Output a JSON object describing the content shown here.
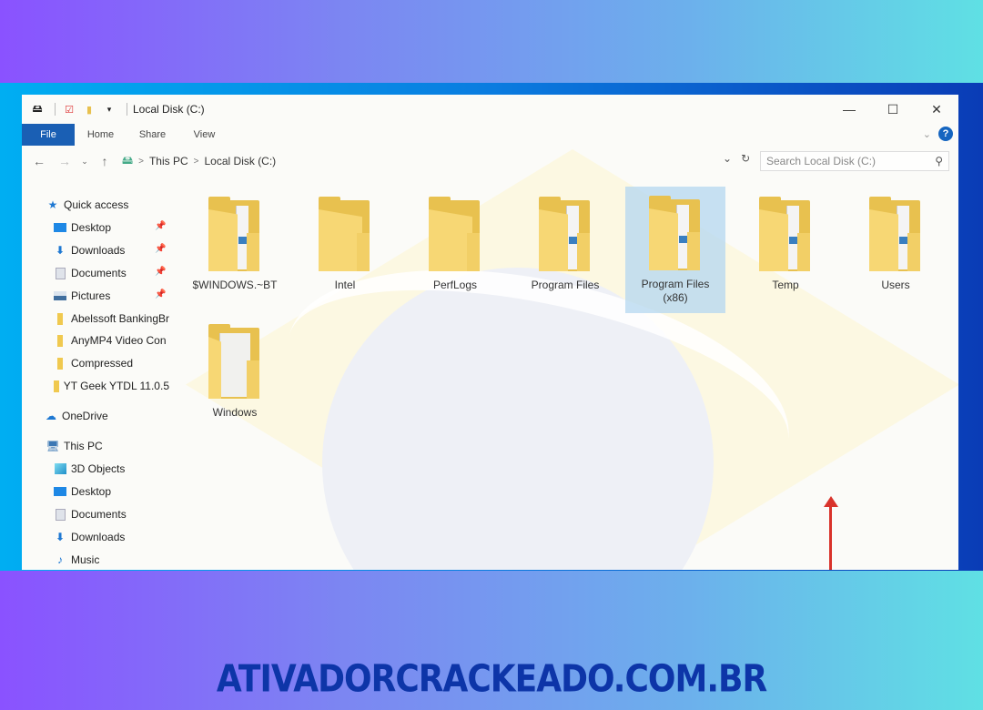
{
  "window": {
    "title": "Local Disk (C:)",
    "controls": {
      "minimize": "—",
      "maximize": "☐",
      "close": "✕"
    }
  },
  "ribbon": {
    "tabs": [
      "File",
      "Home",
      "Share",
      "View"
    ]
  },
  "address_bar": {
    "path": [
      "This PC",
      "Local Disk (C:)"
    ],
    "separator": ">",
    "search_placeholder": "Search Local Disk (C:)"
  },
  "sidebar": {
    "quick_access": {
      "label": "Quick access",
      "items": [
        {
          "label": "Desktop",
          "icon": "desktop-icon",
          "pinned": true
        },
        {
          "label": "Downloads",
          "icon": "download-icon",
          "pinned": true
        },
        {
          "label": "Documents",
          "icon": "documents-icon",
          "pinned": true
        },
        {
          "label": "Pictures",
          "icon": "pictures-icon",
          "pinned": true
        },
        {
          "label": "Abelssoft BankingBr",
          "icon": "folder-icon",
          "pinned": false
        },
        {
          "label": "AnyMP4 Video Con",
          "icon": "folder-icon",
          "pinned": false
        },
        {
          "label": "Compressed",
          "icon": "folder-icon",
          "pinned": false
        },
        {
          "label": "YT Geek YTDL 11.0.5",
          "icon": "folder-icon",
          "pinned": false
        }
      ]
    },
    "onedrive": {
      "label": "OneDrive"
    },
    "this_pc": {
      "label": "This PC",
      "items": [
        {
          "label": "3D Objects",
          "icon": "3d-objects-icon"
        },
        {
          "label": "Desktop",
          "icon": "desktop-icon"
        },
        {
          "label": "Documents",
          "icon": "documents-icon"
        },
        {
          "label": "Downloads",
          "icon": "download-icon"
        },
        {
          "label": "Music",
          "icon": "music-icon"
        }
      ]
    }
  },
  "folders": [
    {
      "name": "$WINDOWS.~BT",
      "style": "docs",
      "selected": false
    },
    {
      "name": "Intel",
      "style": "plain",
      "selected": false
    },
    {
      "name": "PerfLogs",
      "style": "plain",
      "selected": false
    },
    {
      "name": "Program Files",
      "style": "docs",
      "selected": false
    },
    {
      "name": "Program Files\n(x86)",
      "line1": "Program Files",
      "line2": "(x86)",
      "style": "docs",
      "selected": true
    },
    {
      "name": "Temp",
      "style": "docs",
      "selected": false
    },
    {
      "name": "Users",
      "style": "docs",
      "selected": false
    },
    {
      "name": "Windows",
      "style": "white",
      "selected": false
    }
  ],
  "annotation": {
    "arrow_color": "#d9332b",
    "points_to": "Program Files (x86)"
  },
  "colors": {
    "file_tab": "#1a5fb4",
    "selection": "#b4d7f0",
    "watermark_text": "#0d35a8"
  },
  "footer": {
    "watermark": "ATIVADORCRACKEADO.COM.BR"
  }
}
